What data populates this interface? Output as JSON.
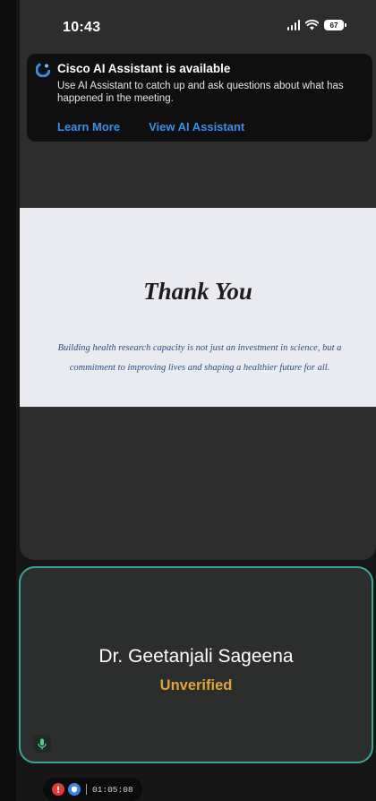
{
  "status_bar": {
    "time": "10:43",
    "battery": "67"
  },
  "ai_banner": {
    "title": "Cisco AI Assistant is available",
    "description": "Use AI Assistant to catch up and ask questions about what has happened in the meeting.",
    "learn_more": "Learn More",
    "view_assistant": "View AI Assistant",
    "accent_color": "#3b8ee8"
  },
  "shared_slide": {
    "title": "Thank You",
    "body": "Building health research capacity is not just an investment in science, but a commitment to improving lives and shaping a healthier future for all."
  },
  "participant": {
    "name": "Dr. Geetanjali Sageena",
    "status": "Unverified",
    "status_color": "#e3a33b",
    "border_color": "#3aa596"
  },
  "meeting_bar": {
    "timer": "01:05:08"
  }
}
